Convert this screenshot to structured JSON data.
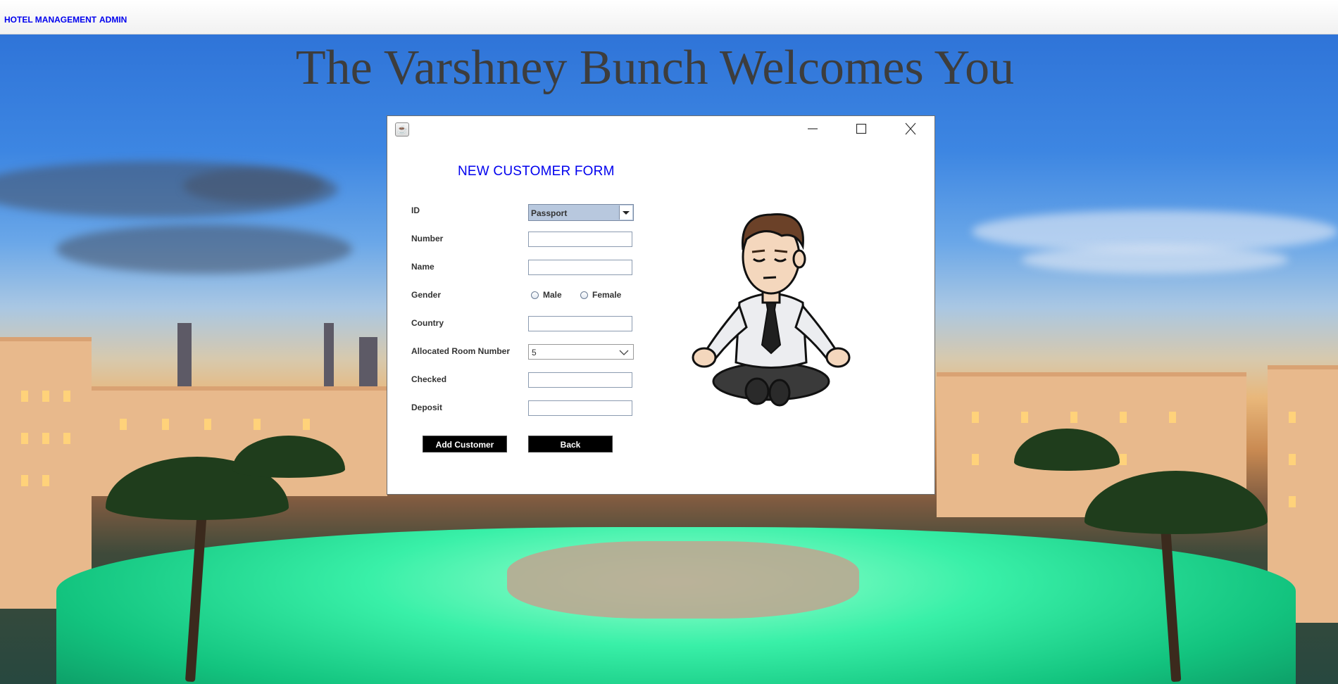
{
  "menubar": {
    "items": [
      {
        "label": "HOTEL MANAGEMENT"
      },
      {
        "label": "ADMIN"
      }
    ]
  },
  "hero": {
    "title": "The Varshney Bunch Welcomes You"
  },
  "dialog": {
    "icon": "java-cup-icon",
    "form_title": "NEW CUSTOMER FORM",
    "fields": {
      "id": {
        "label": "ID",
        "value": "Passport"
      },
      "number": {
        "label": "Number",
        "value": ""
      },
      "name": {
        "label": "Name",
        "value": ""
      },
      "gender": {
        "label": "Gender",
        "options": [
          "Male",
          "Female"
        ]
      },
      "country": {
        "label": "Country",
        "value": ""
      },
      "room": {
        "label": "Allocated Room Number",
        "value": "5"
      },
      "checked": {
        "label": "Checked",
        "value": ""
      },
      "deposit": {
        "label": "Deposit",
        "value": ""
      }
    },
    "buttons": {
      "add": "Add Customer",
      "back": "Back"
    }
  },
  "colors": {
    "accent_blue": "#0000ee",
    "title_gray": "#3d3d3d",
    "button_bg": "#000000"
  }
}
